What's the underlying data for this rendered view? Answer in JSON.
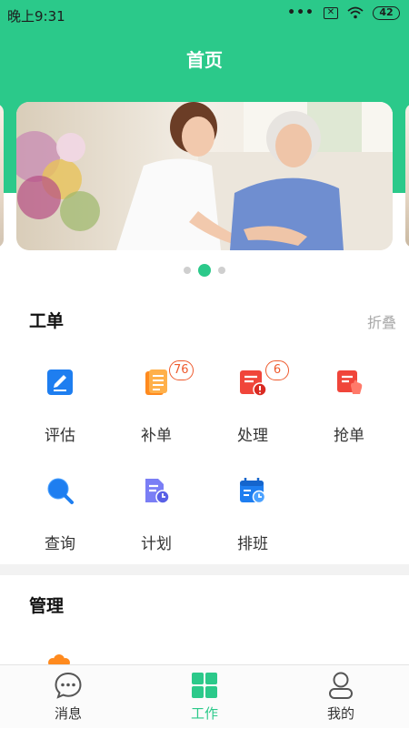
{
  "status_bar": {
    "time": "晚上9:31",
    "battery": "42"
  },
  "header": {
    "title": "首页"
  },
  "banner": {
    "pages": 3,
    "active_page": 2
  },
  "work_orders": {
    "title": "工单",
    "collapse_label": "折叠",
    "items": [
      {
        "label": "评估",
        "icon": "edit-icon"
      },
      {
        "label": "补单",
        "icon": "document-list-icon",
        "badge": "76"
      },
      {
        "label": "处理",
        "icon": "document-alert-icon",
        "badge": "6"
      },
      {
        "label": "抢单",
        "icon": "grab-order-icon"
      },
      {
        "label": "查询",
        "icon": "search-icon"
      },
      {
        "label": "计划",
        "icon": "plan-icon"
      },
      {
        "label": "排班",
        "icon": "calendar-icon"
      }
    ]
  },
  "management": {
    "title": "管理"
  },
  "tabbar": {
    "items": [
      {
        "label": "消息",
        "icon": "message-icon"
      },
      {
        "label": "工作",
        "icon": "grid-icon",
        "active": true
      },
      {
        "label": "我的",
        "icon": "profile-icon"
      }
    ]
  },
  "colors": {
    "accent": "#2bc98a",
    "badge": "#ee5a2d",
    "blue": "#1e7ef0",
    "orange": "#ff8a1e",
    "red": "#f0453a",
    "purple": "#7a7ef5"
  }
}
